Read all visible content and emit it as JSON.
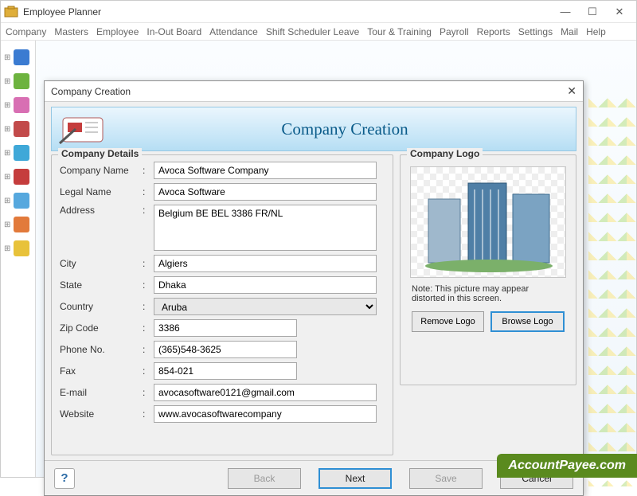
{
  "window": {
    "title": "Employee Planner",
    "controls": {
      "min": "—",
      "max": "☐",
      "close": "✕"
    }
  },
  "menubar": [
    "Company",
    "Masters",
    "Employee",
    "In-Out Board",
    "Attendance",
    "Shift Scheduler Leave",
    "Tour & Training",
    "Payroll",
    "Reports",
    "Settings",
    "Mail",
    "Help"
  ],
  "sidebar_colors": [
    "#3b7bd1",
    "#6db33f",
    "#d86fb3",
    "#c24a4a",
    "#3fa8d8",
    "#c53d3d",
    "#56a8de",
    "#e27a3b",
    "#e8c23a"
  ],
  "dialog": {
    "title": "Company Creation",
    "hero": "Company Creation",
    "groups": {
      "details": "Company Details",
      "logo": "Company Logo"
    },
    "fields": {
      "company_name": {
        "label": "Company Name",
        "value": "Avoca Software Company"
      },
      "legal_name": {
        "label": "Legal Name",
        "value": "Avoca Software"
      },
      "address": {
        "label": "Address",
        "value": "Belgium BE BEL 3386 FR/NL"
      },
      "city": {
        "label": "City",
        "value": "Algiers"
      },
      "state": {
        "label": "State",
        "value": "Dhaka"
      },
      "country": {
        "label": "Country",
        "value": "Aruba"
      },
      "zip": {
        "label": "Zip Code",
        "value": "3386"
      },
      "phone": {
        "label": "Phone No.",
        "value": "(365)548-3625"
      },
      "fax": {
        "label": "Fax",
        "value": "854-021"
      },
      "email": {
        "label": "E-mail",
        "value": "avocasoftware0121@gmail.com"
      },
      "website": {
        "label": "Website",
        "value": "www.avocasoftwarecompany"
      }
    },
    "logo_note": "Note: This picture may appear distorted in this screen.",
    "logo_buttons": {
      "remove": "Remove Logo",
      "browse": "Browse Logo"
    },
    "footer": {
      "back": "Back",
      "next": "Next",
      "save": "Save",
      "cancel": "Cancel"
    }
  },
  "brand": "AccountPayee.com"
}
